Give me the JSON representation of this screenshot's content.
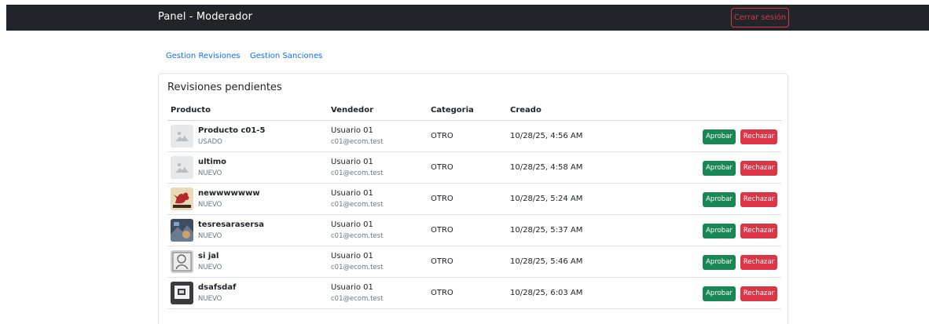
{
  "header": {
    "title": "Panel - Moderador",
    "logout_label": "Cerrar sesión"
  },
  "tabs": [
    {
      "label": "Gestion Revisiones"
    },
    {
      "label": "Gestion Sanciones"
    }
  ],
  "card": {
    "title": "Revisiones pendientes",
    "columns": [
      "Producto",
      "Vendedor",
      "Categoria",
      "Creado"
    ],
    "approve_label": "Aprobar",
    "reject_label": "Rechazar"
  },
  "rows": [
    {
      "product": "Producto c01-5",
      "condition": "USADO",
      "seller": "Usuario 01",
      "email": "c01@ecom.test",
      "category": "OTRO",
      "created": "10/28/25, 4:56 AM",
      "thumb": "placeholder-image-icon"
    },
    {
      "product": "ultimo",
      "condition": "NUEVO",
      "seller": "Usuario 01",
      "email": "c01@ecom.test",
      "category": "OTRO",
      "created": "10/28/25, 4:58 AM",
      "thumb": "placeholder-image-icon"
    },
    {
      "product": "newwwwwww",
      "condition": "NUEVO",
      "seller": "Usuario 01",
      "email": "c01@ecom.test",
      "category": "OTRO",
      "created": "10/28/25, 5:24 AM",
      "thumb": "dragon-image"
    },
    {
      "product": "tesresarasersa",
      "condition": "NUEVO",
      "seller": "Usuario 01",
      "email": "c01@ecom.test",
      "category": "OTRO",
      "created": "10/28/25, 5:37 AM",
      "thumb": "photo-image"
    },
    {
      "product": "si jal",
      "condition": "NUEVO",
      "seller": "Usuario 01",
      "email": "c01@ecom.test",
      "category": "OTRO",
      "created": "10/28/25, 5:46 AM",
      "thumb": "sketch-image"
    },
    {
      "product": "dsafsdaf",
      "condition": "NUEVO",
      "seller": "Usuario 01",
      "email": "c01@ecom.test",
      "category": "OTRO",
      "created": "10/28/25, 6:03 AM",
      "thumb": "screen-image"
    }
  ]
}
